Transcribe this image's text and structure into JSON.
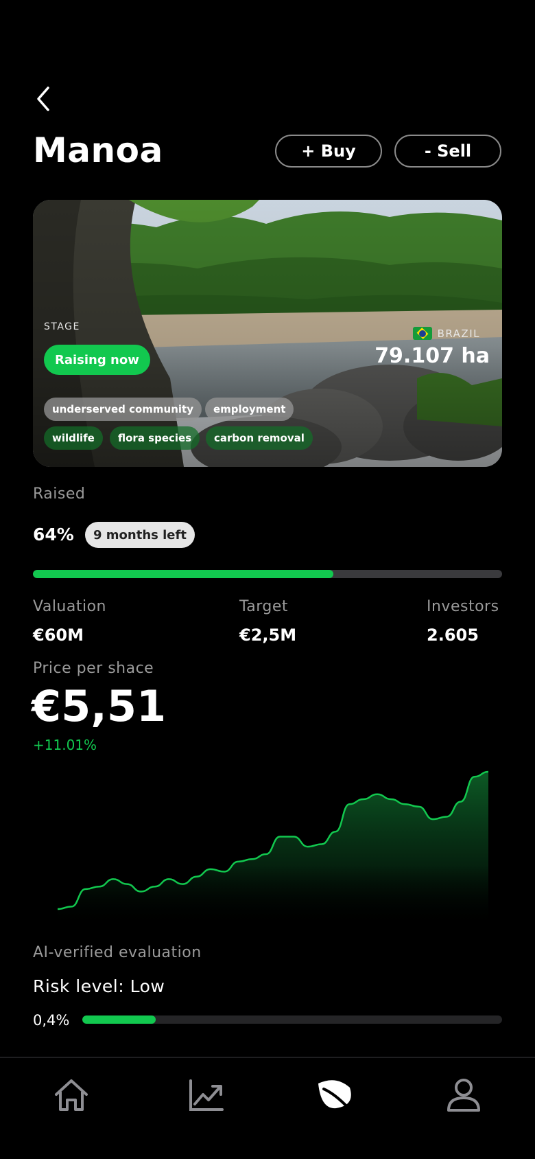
{
  "header": {
    "title": "Manoa",
    "buy_label": "+ Buy",
    "sell_label": "- Sell"
  },
  "hero": {
    "stage_label": "STAGE",
    "stage_value": "Raising now",
    "country": "BRAZIL",
    "area": "79.107 ha",
    "tags": [
      "underserved community",
      "employment",
      "wildlife",
      "flora species",
      "carbon removal"
    ]
  },
  "raised": {
    "label": "Raised",
    "percent_text": "64%",
    "percent": 0.64,
    "time_left": "9 months left"
  },
  "stats": [
    {
      "label": "Valuation",
      "value": "€60M"
    },
    {
      "label": "Target",
      "value": "€2,5M"
    },
    {
      "label": "Investors",
      "value": "2.605"
    }
  ],
  "price": {
    "label": "Price per shace",
    "value": "€5,51",
    "change": "+11.01%"
  },
  "chart_data": {
    "type": "area",
    "title": "",
    "xlabel": "",
    "ylabel": "",
    "values": [
      1.0,
      1.1,
      1.8,
      1.9,
      2.2,
      2.0,
      1.7,
      1.9,
      2.2,
      2.0,
      2.3,
      2.6,
      2.5,
      2.9,
      3.0,
      3.2,
      3.9,
      3.9,
      3.5,
      3.6,
      4.1,
      5.2,
      5.4,
      5.6,
      5.4,
      5.2,
      5.1,
      4.6,
      4.7,
      5.3,
      6.3,
      6.5
    ],
    "color": "#12c84f",
    "grid": false
  },
  "ai": {
    "label": "AI-verified evaluation",
    "risk_text": "Risk level: Low",
    "risk_percent_text": "0,4%",
    "risk_fill": 0.175
  },
  "nav": {
    "items": [
      {
        "icon": "home-icon",
        "active": false
      },
      {
        "icon": "chart-icon",
        "active": false
      },
      {
        "icon": "leaf-icon",
        "active": true
      },
      {
        "icon": "profile-icon",
        "active": false
      }
    ]
  },
  "colors": {
    "accent": "#12c84f",
    "background": "#000000",
    "muted": "#9a9a9a"
  }
}
